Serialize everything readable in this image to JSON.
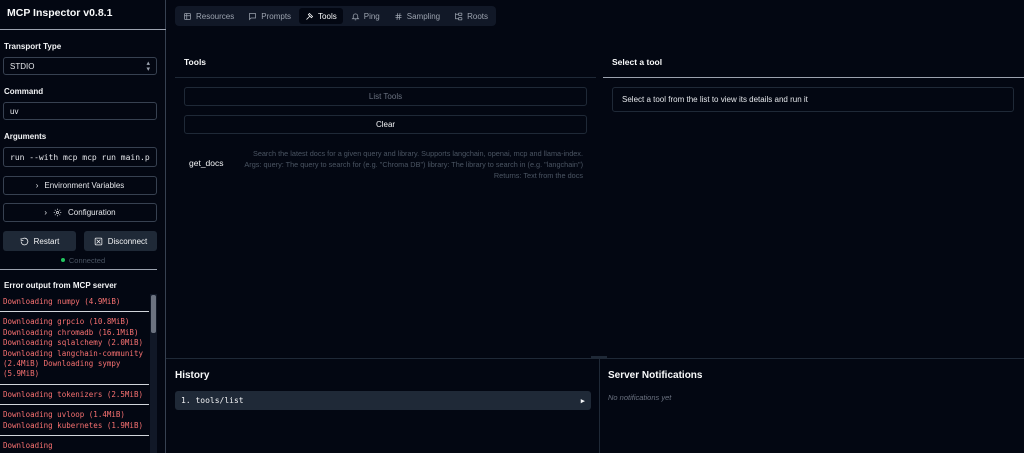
{
  "app": {
    "title": "MCP Inspector v0.8.1"
  },
  "sidebar": {
    "transport_label": "Transport Type",
    "transport_value": "STDIO",
    "command_label": "Command",
    "command_value": "uv",
    "arguments_label": "Arguments",
    "arguments_value": "run --with mcp mcp run main.py",
    "env_button": "Environment Variables",
    "config_button": "Configuration",
    "restart_button": "Restart",
    "disconnect_button": "Disconnect",
    "status": "Connected",
    "error_title": "Error output from MCP server",
    "log_entries": [
      "Downloading numpy (4.9MiB)",
      "Downloading grpcio (10.8MiB)\nDownloading chromadb (16.1MiB)\nDownloading sqlalchemy (2.0MiB)\nDownloading langchain-community (2.4MiB) Downloading sympy (5.9MiB)",
      "Downloading tokenizers (2.5MiB)",
      "Downloading uvloop (1.4MiB)\nDownloading kubernetes (1.9MiB)",
      "Downloading"
    ]
  },
  "tabs": [
    {
      "label": "Resources",
      "icon": "files-icon",
      "active": false
    },
    {
      "label": "Prompts",
      "icon": "message-icon",
      "active": false
    },
    {
      "label": "Tools",
      "icon": "hammer-icon",
      "active": true
    },
    {
      "label": "Ping",
      "icon": "bell-icon",
      "active": false
    },
    {
      "label": "Sampling",
      "icon": "hash-icon",
      "active": false
    },
    {
      "label": "Roots",
      "icon": "folder-tree-icon",
      "active": false
    }
  ],
  "tools": {
    "title": "Tools",
    "list_button": "List Tools",
    "clear_button": "Clear",
    "items": [
      {
        "name": "get_docs",
        "description": "Search the latest docs for a given query and library. Supports langchain, openai, mcp and llama-index. Args: query: The query to search for (e.g. \"Chroma DB\") library: The library to search in (e.g. \"langchain\") Returns: Text from the docs"
      }
    ]
  },
  "detail": {
    "title": "Select a tool",
    "placeholder": "Select a tool from the list to view its details and run it"
  },
  "history": {
    "title": "History",
    "items": [
      {
        "label": "1. tools/list"
      }
    ]
  },
  "notifications": {
    "title": "Server Notifications",
    "empty": "No notifications yet"
  },
  "colors": {
    "background": "#030712",
    "border": "#374151",
    "error_text": "#f87171",
    "status_dot": "#22c55e",
    "muted": "#4b5563"
  }
}
